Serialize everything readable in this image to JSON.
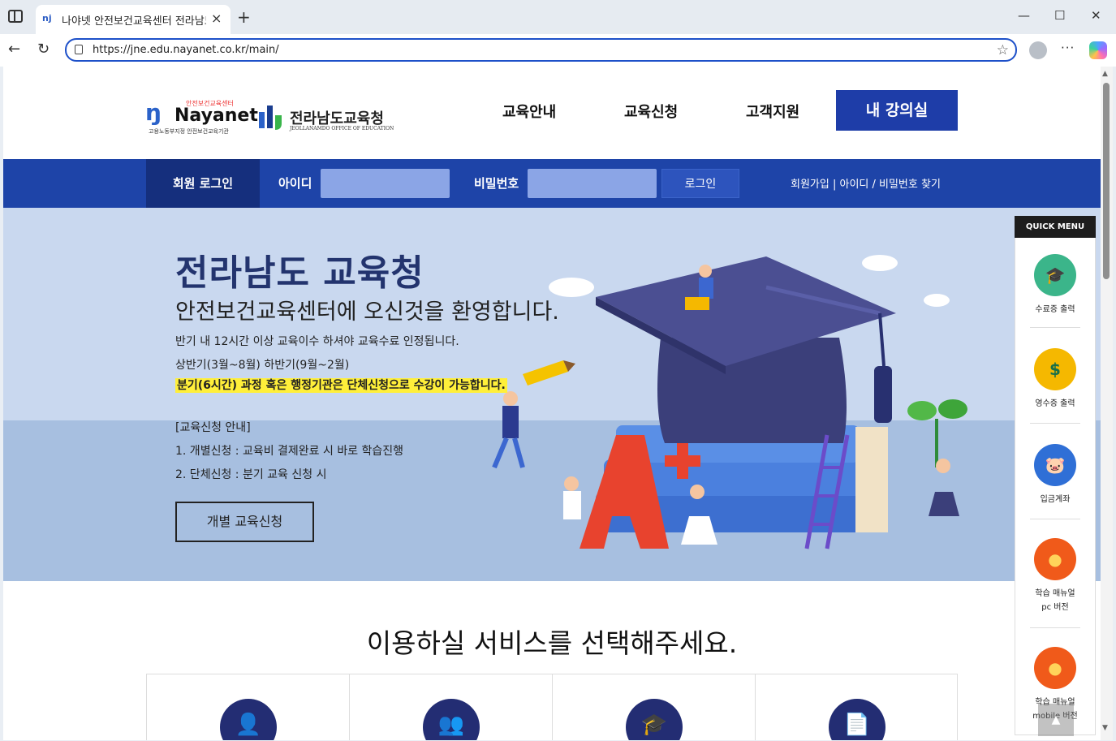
{
  "browser": {
    "tab_title": "나야넷 안전보건교육센터 전라남도",
    "tab_favicon": "nj",
    "url": "https://jne.edu.nayanet.co.kr/main/"
  },
  "header": {
    "logo_sub": "안전보건교육센터",
    "logo_name": "Nayanet",
    "logo_caption": "고용노동부지정 안전보건교육기관",
    "partner_name": "전라남도교육청",
    "partner_en": "JEOLLANAMDO OFFICE OF EDUCATION",
    "nav": [
      "교육안내",
      "교육신청",
      "고객지원"
    ],
    "lecture_room": "내 강의실"
  },
  "login": {
    "tab": "회원 로그인",
    "id_label": "아이디",
    "pw_label": "비밀번호",
    "button": "로그인",
    "links": "회원가입 | 아이디 / 비밀번호 찾기"
  },
  "hero": {
    "title": "전라남도 교육청",
    "subtitle": "안전보건교육센터에 오신것을 환영합니다.",
    "line1": "반기 내 12시간 이상 교육이수 하셔야 교육수료 인정됩니다.",
    "line2": "상반기(3월~8월) 하반기(9월~2월)",
    "highlight": "분기(6시간) 과정 혹은 행정기관은 단체신청으로 수강이 가능합니다.",
    "guide_title": "[교육신청 안내]",
    "guide1": "1. 개별신청 : 교육비 결제완료 시 바로 학습진행",
    "guide2": "2. 단체신청 : 분기 교육 신청 시",
    "button": "개별 교육신청"
  },
  "quick_menu": {
    "title": "QUICK MENU",
    "items": [
      {
        "label": "수료증 출력",
        "icon": "graduation-cap-icon",
        "color": "#3bb58a"
      },
      {
        "label": "영수증 출력",
        "icon": "receipt-icon",
        "color": "#f5b800"
      },
      {
        "label": "입금계좌",
        "icon": "piggy-bank-icon",
        "color": "#2f6fd6"
      },
      {
        "label": "학습 매뉴얼\npc 버전",
        "icon": "chat-bubble-icon",
        "color": "#f05a1a"
      },
      {
        "label": "학습 매뉴얼\nmobile 버전",
        "icon": "chat-bubble-icon",
        "color": "#f05a1a"
      }
    ],
    "top": "▲"
  },
  "services": {
    "title": "이용하실 서비스를 선택해주세요.",
    "cards": [
      {
        "icon": "person-icon",
        "glyph": "👤"
      },
      {
        "icon": "group-icon",
        "glyph": "👥"
      },
      {
        "icon": "graduation-cap-icon",
        "glyph": "🎓"
      },
      {
        "icon": "document-icon",
        "glyph": "📄"
      }
    ]
  }
}
